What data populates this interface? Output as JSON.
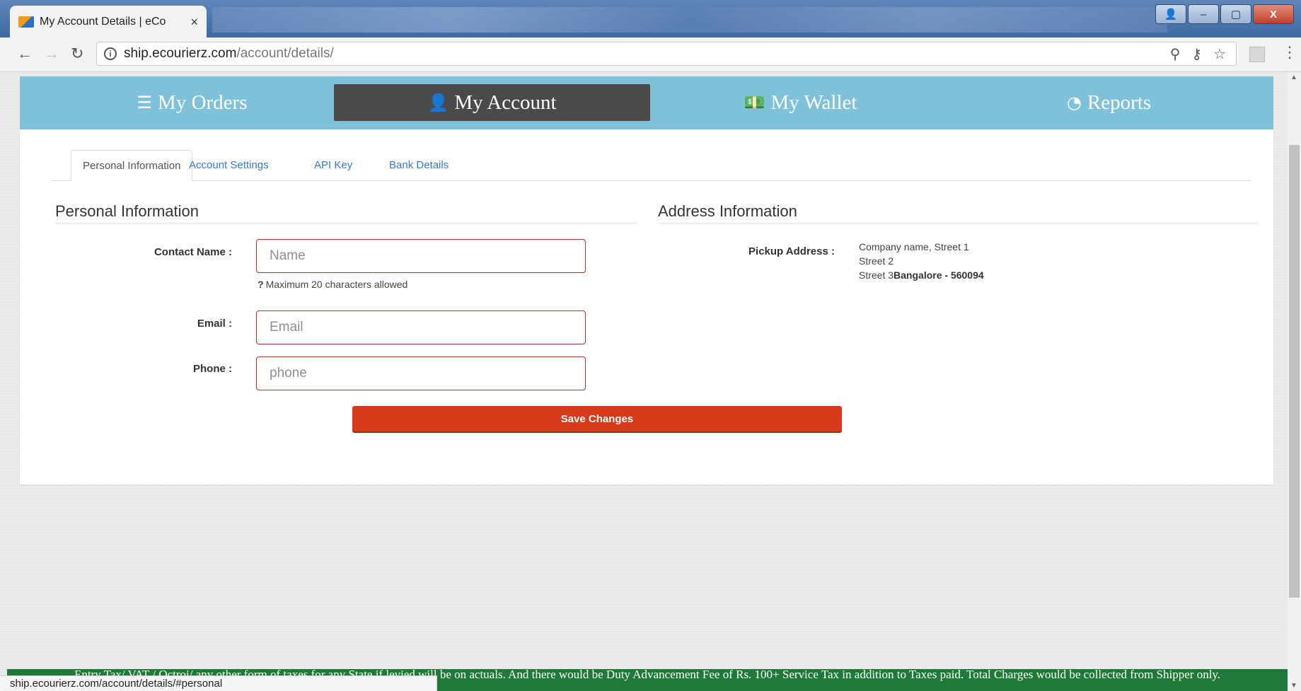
{
  "browser": {
    "tab_title": "My Account Details | eCo",
    "tab_close": "×",
    "url_host": "ship.ecourierz.com",
    "url_path": "/account/details/",
    "status_url": "ship.ecourierz.com/account/details/#personal",
    "window_buttons": {
      "user": "👤",
      "minimize": "–",
      "maximize": "▢",
      "close": "X"
    }
  },
  "main_nav": [
    {
      "icon": "☰",
      "label": "My Orders",
      "active": false
    },
    {
      "icon": "👤",
      "label": "My Account",
      "active": true
    },
    {
      "icon": "💵",
      "label": "My Wallet",
      "active": false
    },
    {
      "icon": "◔",
      "label": "Reports",
      "active": false
    }
  ],
  "sub_tabs": [
    "Personal Information",
    "Account Settings",
    "API Key",
    "Bank Details"
  ],
  "personal": {
    "title": "Personal Information",
    "contact_label": "Contact Name :",
    "contact_placeholder": "Name",
    "contact_hint_mark": "?",
    "contact_hint": "Maximum 20 characters allowed",
    "email_label": "Email :",
    "email_placeholder": "Email",
    "phone_label": "Phone :",
    "phone_placeholder": "phone",
    "save_label": "Save Changes"
  },
  "address": {
    "title": "Address Information",
    "pickup_label": "Pickup Address :",
    "line1": "Company name, Street 1",
    "line2": "Street 2",
    "line3": "Street 3",
    "city_pin": "Bangalore - 560094"
  },
  "footer": {
    "notice": "Entry Tax/ VAT / Octroi/ any other form of taxes for any State if levied will be on actuals. And there would be Duty Advancement Fee of Rs. 100+ Service Tax in addition to Taxes paid. Total Charges would be collected from Shipper only."
  },
  "colors": {
    "nav_bar": "#7ec1d8",
    "nav_active": "#4a4a4a",
    "input_border": "#b33232",
    "save_button": "#d63a1a",
    "footer_banner": "#1f7a3a",
    "tab_link": "#3a7bc8"
  }
}
